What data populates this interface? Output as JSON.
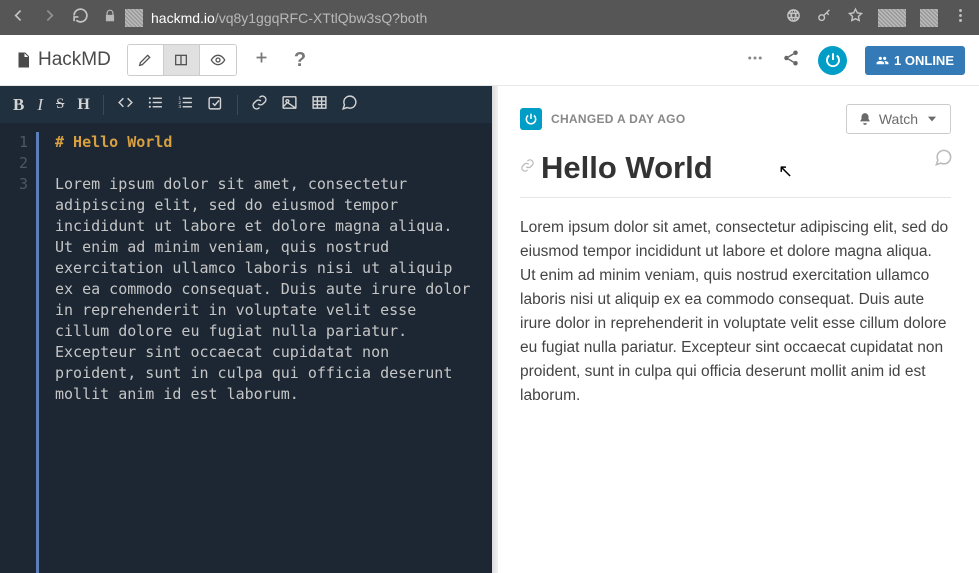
{
  "browser": {
    "url_host": "hackmd.io",
    "url_path": "/vq8y1ggqRFC-XTtlQbw3sQ?both"
  },
  "app": {
    "name": "HackMD",
    "online_label": "1 ONLINE"
  },
  "editor": {
    "lines": [
      "1",
      "2",
      "3"
    ],
    "heading_src": "# Hello World",
    "body_src": "Lorem ipsum dolor sit amet, consectetur adipiscing elit, sed do eiusmod tempor incididunt ut labore et dolore magna aliqua. Ut enim ad minim veniam, quis nostrud exercitation ullamco laboris nisi ut aliquip ex ea commodo consequat. Duis aute irure dolor in reprehenderit in voluptate velit esse cillum dolore eu fugiat nulla pariatur. Excepteur sint occaecat cupidatat non proident, sunt in culpa qui officia deserunt mollit anim id est laborum."
  },
  "preview": {
    "changed_label": "CHANGED A DAY AGO",
    "watch_label": "Watch",
    "title": "Hello World",
    "body": "Lorem ipsum dolor sit amet, consectetur adipiscing elit, sed do eiusmod tempor incididunt ut labore et dolore magna aliqua. Ut enim ad minim veniam, quis nostrud exercitation ullamco laboris nisi ut aliquip ex ea commodo consequat. Duis aute irure dolor in reprehenderit in voluptate velit esse cillum dolore eu fugiat nulla pariatur. Excepteur sint occaecat cupidatat non proident, sunt in culpa qui officia deserunt mollit anim id est laborum."
  },
  "toolbar": {
    "bold": "B",
    "italic": "I",
    "strike": "S",
    "heading": "H"
  }
}
